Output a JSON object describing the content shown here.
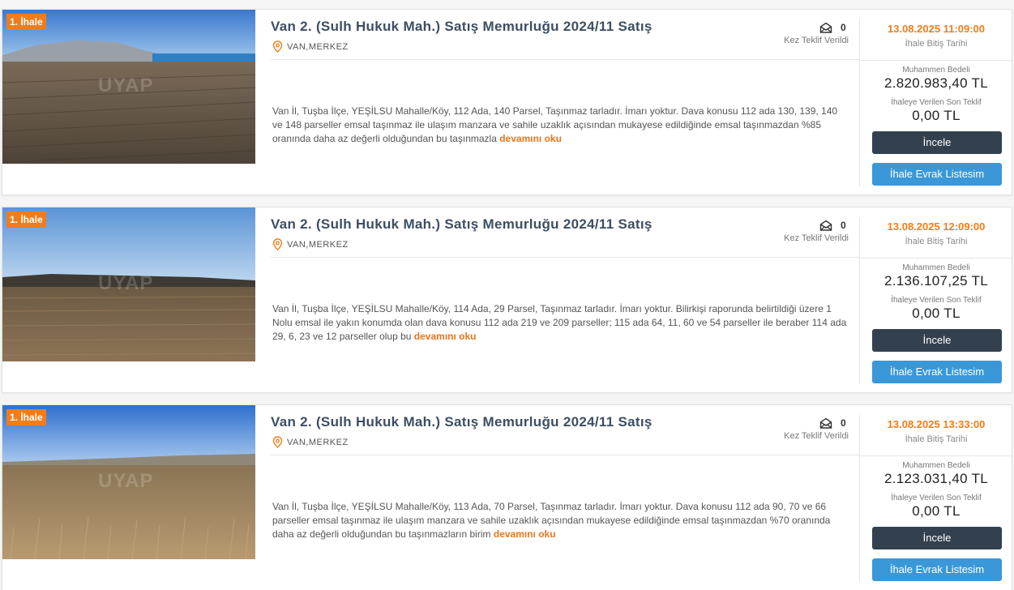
{
  "listings": [
    {
      "badge": "1. İhale",
      "watermark": "UYAP",
      "title": "Van 2. (Sulh Hukuk Mah.) Satış Memurluğu 2024/11 Satış",
      "location": "VAN,MERKEZ",
      "offer_count": "0",
      "offer_label": "Kez Teklif Verildi",
      "end_date": "13.08.2025 11:09:00",
      "end_label": "İhale Bitiş Tarihi",
      "estimate_label": "Muhammen Bedeli",
      "estimate_value": "2.820.983,40 TL",
      "last_bid_label": "İhaleye Verilen Son Teklif",
      "last_bid_value": "0,00 TL",
      "description": "Van İl, Tuşba İlçe, YEŞİLSU Mahalle/Köy, 112 Ada, 140 Parsel, Taşınmaz tarladır. İmarı yoktur. Dava konusu 112 ada 130, 139, 140 ve 148 parseller emsal taşınmaz ile ulaşım manzara ve sahile uzaklık açısından mukayese edildiğinde emsal taşınmazdan %85 oranında daha az değerli olduğundan bu taşınmazla",
      "more_label": "devamını oku",
      "inspect_label": "İncele",
      "docs_label": "İhale Evrak Listesim"
    },
    {
      "badge": "1. İhale",
      "watermark": "UYAP",
      "title": "Van 2. (Sulh Hukuk Mah.) Satış Memurluğu 2024/11 Satış",
      "location": "VAN,MERKEZ",
      "offer_count": "0",
      "offer_label": "Kez Teklif Verildi",
      "end_date": "13.08.2025 12:09:00",
      "end_label": "İhale Bitiş Tarihi",
      "estimate_label": "Muhammen Bedeli",
      "estimate_value": "2.136.107,25 TL",
      "last_bid_label": "İhaleye Verilen Son Teklif",
      "last_bid_value": "0,00 TL",
      "description": "Van İl, Tuşba İlçe, YEŞİLSU Mahalle/Köy, 114 Ada, 29 Parsel, Taşınmaz tarladır. İmarı yoktur. Bilirkişi raporunda belirtildiği üzere 1 Nolu emsal ile yakın konumda olan dava konusu 112 ada 219 ve 209 parseller; 115 ada 64, 11, 60 ve 54 parseller ile beraber 114 ada 29, 6, 23 ve 12 parseller olup bu",
      "more_label": "devamını oku",
      "inspect_label": "İncele",
      "docs_label": "İhale Evrak Listesim"
    },
    {
      "badge": "1. İhale",
      "watermark": "UYAP",
      "title": "Van 2. (Sulh Hukuk Mah.) Satış Memurluğu 2024/11 Satış",
      "location": "VAN,MERKEZ",
      "offer_count": "0",
      "offer_label": "Kez Teklif Verildi",
      "end_date": "13.08.2025 13:33:00",
      "end_label": "İhale Bitiş Tarihi",
      "estimate_label": "Muhammen Bedeli",
      "estimate_value": "2.123.031,40 TL",
      "last_bid_label": "İhaleye Verilen Son Teklif",
      "last_bid_value": "0,00 TL",
      "description": "Van İl, Tuşba İlçe, YEŞİLSU Mahalle/Köy, 113 Ada, 70 Parsel, Taşınmaz tarladır. İmarı yoktur. Dava konusu 112 ada 90, 70 ve 66 parseller emsal taşınmaz ile ulaşım manzara ve sahile uzaklık açısından mukayese edildiğinde emsal taşınmazdan %70 oranında daha az değerli olduğundan bu taşınmazların birim",
      "more_label": "devamını oku",
      "inspect_label": "İncele",
      "docs_label": "İhale Evrak Listesim"
    }
  ],
  "icons": {
    "location": "map-pin-icon",
    "offers": "envelope-open-icon"
  },
  "colors": {
    "accent_orange": "#f07d1a",
    "title": "#3d4e63",
    "inspect_button": "#33414f",
    "docs_button": "#3a98d9"
  }
}
